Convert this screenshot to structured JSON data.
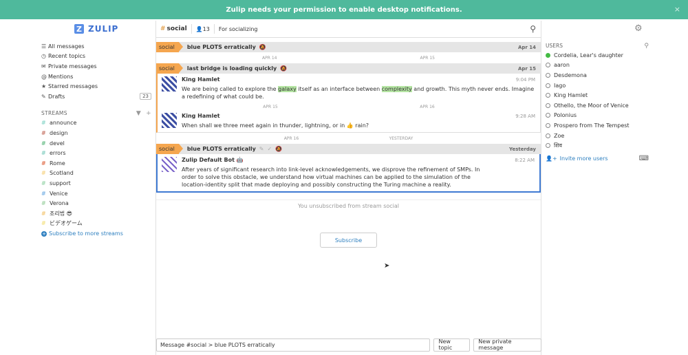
{
  "banner": {
    "text": "Zulip needs your permission to enable desktop notifications.",
    "close": "×"
  },
  "logo": {
    "mark": "Z",
    "text": "ZULIP"
  },
  "nav": [
    {
      "icon": "☰",
      "label": "All messages"
    },
    {
      "icon": "◷",
      "label": "Recent topics"
    },
    {
      "icon": "✉",
      "label": "Private messages"
    },
    {
      "icon": "@",
      "label": "Mentions"
    },
    {
      "icon": "★",
      "label": "Starred messages"
    },
    {
      "icon": "✎",
      "label": "Drafts",
      "badge": "23"
    }
  ],
  "streams_label": "STREAMS",
  "streams": [
    {
      "name": "announce",
      "color": "#8fd8cc"
    },
    {
      "name": "design",
      "color": "#c97b6e"
    },
    {
      "name": "devel",
      "color": "#6cbf8a"
    },
    {
      "name": "errors",
      "color": "#8ad1c5"
    },
    {
      "name": "Rome",
      "color": "#e27452"
    },
    {
      "name": "Scotland",
      "color": "#f7d68a"
    },
    {
      "name": "support",
      "color": "#9fd8b0"
    },
    {
      "name": "Venice",
      "color": "#7fb6e6"
    },
    {
      "name": "Verona",
      "color": "#a3d4a8"
    },
    {
      "name": "조리법 😎",
      "color": "#f4c97b"
    },
    {
      "name": "ビデオゲーム",
      "color": "#f4e38a"
    }
  ],
  "subscribe_more": "Subscribe to more streams",
  "topbar": {
    "stream": "social",
    "subscribers": "13",
    "description": "For socializing"
  },
  "recipients": [
    {
      "stream": "social",
      "topic": "blue PLOTS erratically",
      "date": "Apr 14"
    },
    {
      "stream": "social",
      "topic": "last bridge is loading quickly",
      "date": "Apr 15"
    },
    {
      "stream": "social",
      "topic": "blue PLOTS erratically",
      "date": "Yesterday"
    }
  ],
  "date_separators": {
    "a": [
      "APR 14",
      "APR 15"
    ],
    "b": [
      "APR 15",
      "APR 16"
    ],
    "c": [
      "APR 16",
      "YESTERDAY"
    ]
  },
  "messages": [
    {
      "sender": "King Hamlet",
      "time": "9:04 PM",
      "pre": "We are being called to explore the ",
      "h1": "galaxy",
      "mid": " itself as an interface between ",
      "h2": "complexity",
      "post": " and growth. This myth never ends. Imagine a redefining of what could be."
    },
    {
      "sender": "King Hamlet",
      "time": "9:28 AM",
      "text": "When shall we three meet again in thunder, lightning, or in 👍 rain?"
    },
    {
      "sender": "Zulip Default Bot",
      "time": "8:22 AM",
      "text": "After years of significant research into link-level acknowledgements, we disprove the refinement of SMPs. In order to solve this obstacle, we understand how virtual machines can be applied to the simulation of the location-identity split that made deploying and possibly constructing the Turing machine a reality."
    }
  ],
  "unsubscribed_text": "You unsubscribed from stream social",
  "subscribe_button": "Subscribe",
  "compose": {
    "placeholder": "Message #social > blue PLOTS erratically",
    "new_topic": "New topic",
    "new_pm": "New private message"
  },
  "users_label": "USERS",
  "users": [
    {
      "name": "Cordelia, Lear's daughter",
      "online": true
    },
    {
      "name": "aaron",
      "online": false
    },
    {
      "name": "Desdemona",
      "online": false
    },
    {
      "name": "Iago",
      "online": false
    },
    {
      "name": "King Hamlet",
      "online": false
    },
    {
      "name": "Othello, the Moor of Venice",
      "online": false
    },
    {
      "name": "Polonius",
      "online": false
    },
    {
      "name": "Prospero from The Tempest",
      "online": false
    },
    {
      "name": "Zoe",
      "online": false
    },
    {
      "name": "शिव",
      "online": false
    }
  ],
  "invite": "Invite more users"
}
